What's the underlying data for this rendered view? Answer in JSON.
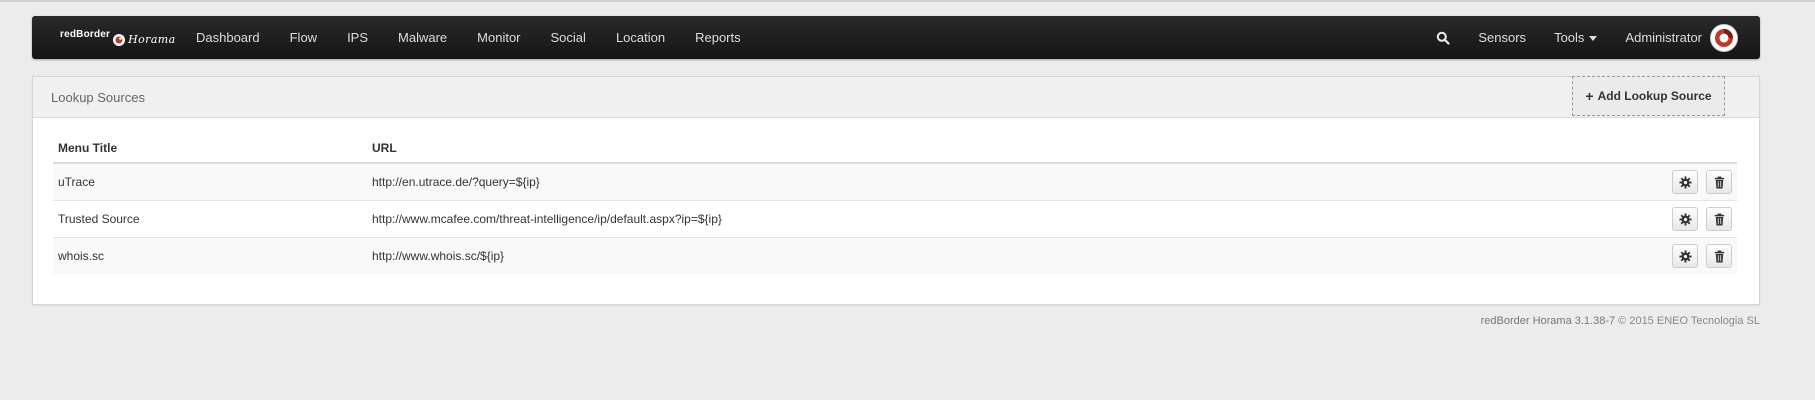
{
  "brand": {
    "name_part1": "redBorder",
    "name_part2": "Horama"
  },
  "nav": {
    "items": [
      {
        "label": "Dashboard"
      },
      {
        "label": "Flow"
      },
      {
        "label": "IPS"
      },
      {
        "label": "Malware"
      },
      {
        "label": "Monitor"
      },
      {
        "label": "Social"
      },
      {
        "label": "Location"
      },
      {
        "label": "Reports"
      }
    ],
    "right": {
      "search_icon": "search-icon",
      "sensors": "Sensors",
      "tools": "Tools",
      "user": "Administrator"
    }
  },
  "panel": {
    "title": "Lookup Sources",
    "add_button": "Add Lookup Source",
    "columns": {
      "menu_title": "Menu Title",
      "url": "URL"
    },
    "rows": [
      {
        "title": "uTrace",
        "url": "http://en.utrace.de/?query=${ip}"
      },
      {
        "title": "Trusted Source",
        "url": "http://www.mcafee.com/threat-intelligence/ip/default.aspx?ip=${ip}"
      },
      {
        "title": "whois.sc",
        "url": "http://www.whois.sc/${ip}"
      }
    ],
    "row_actions": [
      "gear-icon",
      "trash-icon"
    ]
  },
  "footer": {
    "version": "redBorder Horama 3.1.38-7",
    "copyright": "© 2015 ENEO Tecnologia SL"
  },
  "colors": {
    "navbar": "#1c1c1c",
    "page_bg": "#ececec",
    "accent_red": "#c0392b"
  }
}
